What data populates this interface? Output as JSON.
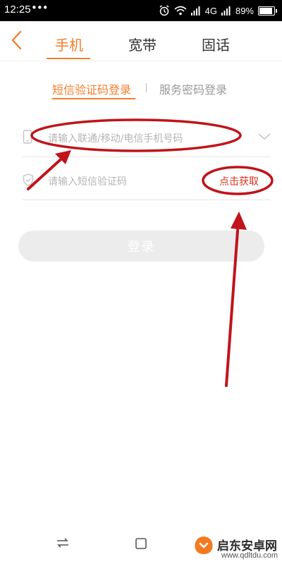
{
  "status_bar": {
    "time": "12:25",
    "dots": "•••",
    "network": "4G",
    "battery": "89%"
  },
  "tabs": [
    {
      "label": "手机",
      "active": true
    },
    {
      "label": "宽带",
      "active": false
    },
    {
      "label": "固话",
      "active": false
    }
  ],
  "login_methods": {
    "active": "短信验证码登录",
    "separator": "|",
    "inactive": "服务密码登录"
  },
  "form": {
    "phone_placeholder": "请输入联通/移动/电信手机号码",
    "code_placeholder": "请输入短信验证码",
    "get_code_label": "点击获取"
  },
  "login_button": "登录",
  "watermark": {
    "text": "启东安卓网",
    "url": "www.qdltdu.com"
  },
  "colors": {
    "accent": "#f27f2e",
    "annotation": "#c0141a",
    "get_code": "#d9311f"
  },
  "icons": [
    "back-icon",
    "phone-icon",
    "shield-check-icon",
    "chevron-down-icon",
    "recent-apps-icon",
    "home-icon",
    "back-nav-icon",
    "alarm-icon",
    "wifi-icon",
    "signal-icon",
    "battery-icon"
  ]
}
